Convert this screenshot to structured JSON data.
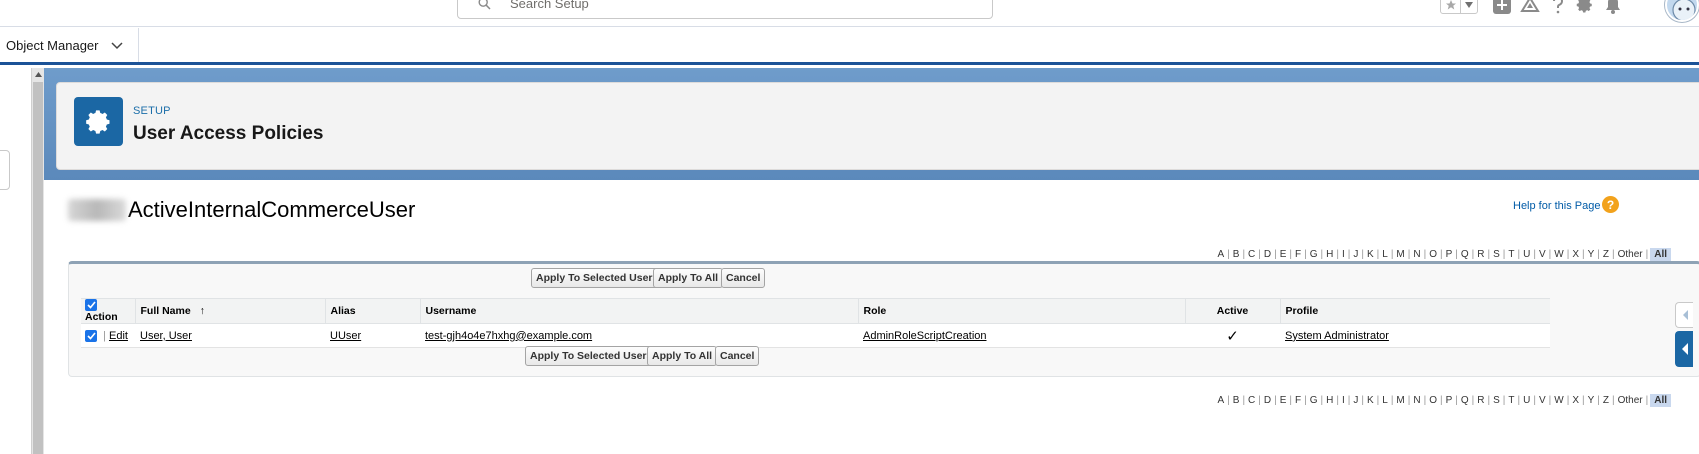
{
  "header": {
    "search_placeholder": "Search Setup",
    "icons": [
      "search-icon",
      "star-icon",
      "chevron-down-icon",
      "add-icon",
      "trailhead-icon",
      "help-icon",
      "gear-icon",
      "bell-icon",
      "avatar"
    ]
  },
  "nav": {
    "object_manager_label": "Object Manager"
  },
  "setup": {
    "label": "SETUP",
    "title": "User Access Policies"
  },
  "page": {
    "title": "ActiveInternalCommerceUser",
    "help_link": "Help for this Page",
    "help_icon_glyph": "?"
  },
  "alphabet": {
    "letters": [
      "A",
      "B",
      "C",
      "D",
      "E",
      "F",
      "G",
      "H",
      "I",
      "J",
      "K",
      "L",
      "M",
      "N",
      "O",
      "P",
      "Q",
      "R",
      "S",
      "T",
      "U",
      "V",
      "W",
      "X",
      "Y",
      "Z"
    ],
    "other": "Other",
    "all": "All"
  },
  "buttons": {
    "apply_selected": "Apply To Selected Users",
    "apply_all": "Apply To All",
    "cancel": "Cancel"
  },
  "table": {
    "columns": {
      "action": "Action",
      "full_name": "Full Name",
      "sort_indicator": "↑",
      "alias": "Alias",
      "username": "Username",
      "role": "Role",
      "active": "Active",
      "profile": "Profile"
    },
    "rows": [
      {
        "selected": true,
        "action_sep": "|",
        "action": "Edit",
        "full_name": "User, User",
        "alias": "UUser",
        "username": "test-gjh4o4e7hxhg@example.com",
        "role": "AdminRoleScriptCreation",
        "active": "✓",
        "profile": "System Administrator"
      }
    ]
  },
  "colors": {
    "brand_blue": "#1b67a4",
    "link_blue": "#015ba7",
    "nav_border": "#1b5297",
    "checkbox_blue": "#1a73e8",
    "help_orange": "#f2a21c"
  }
}
